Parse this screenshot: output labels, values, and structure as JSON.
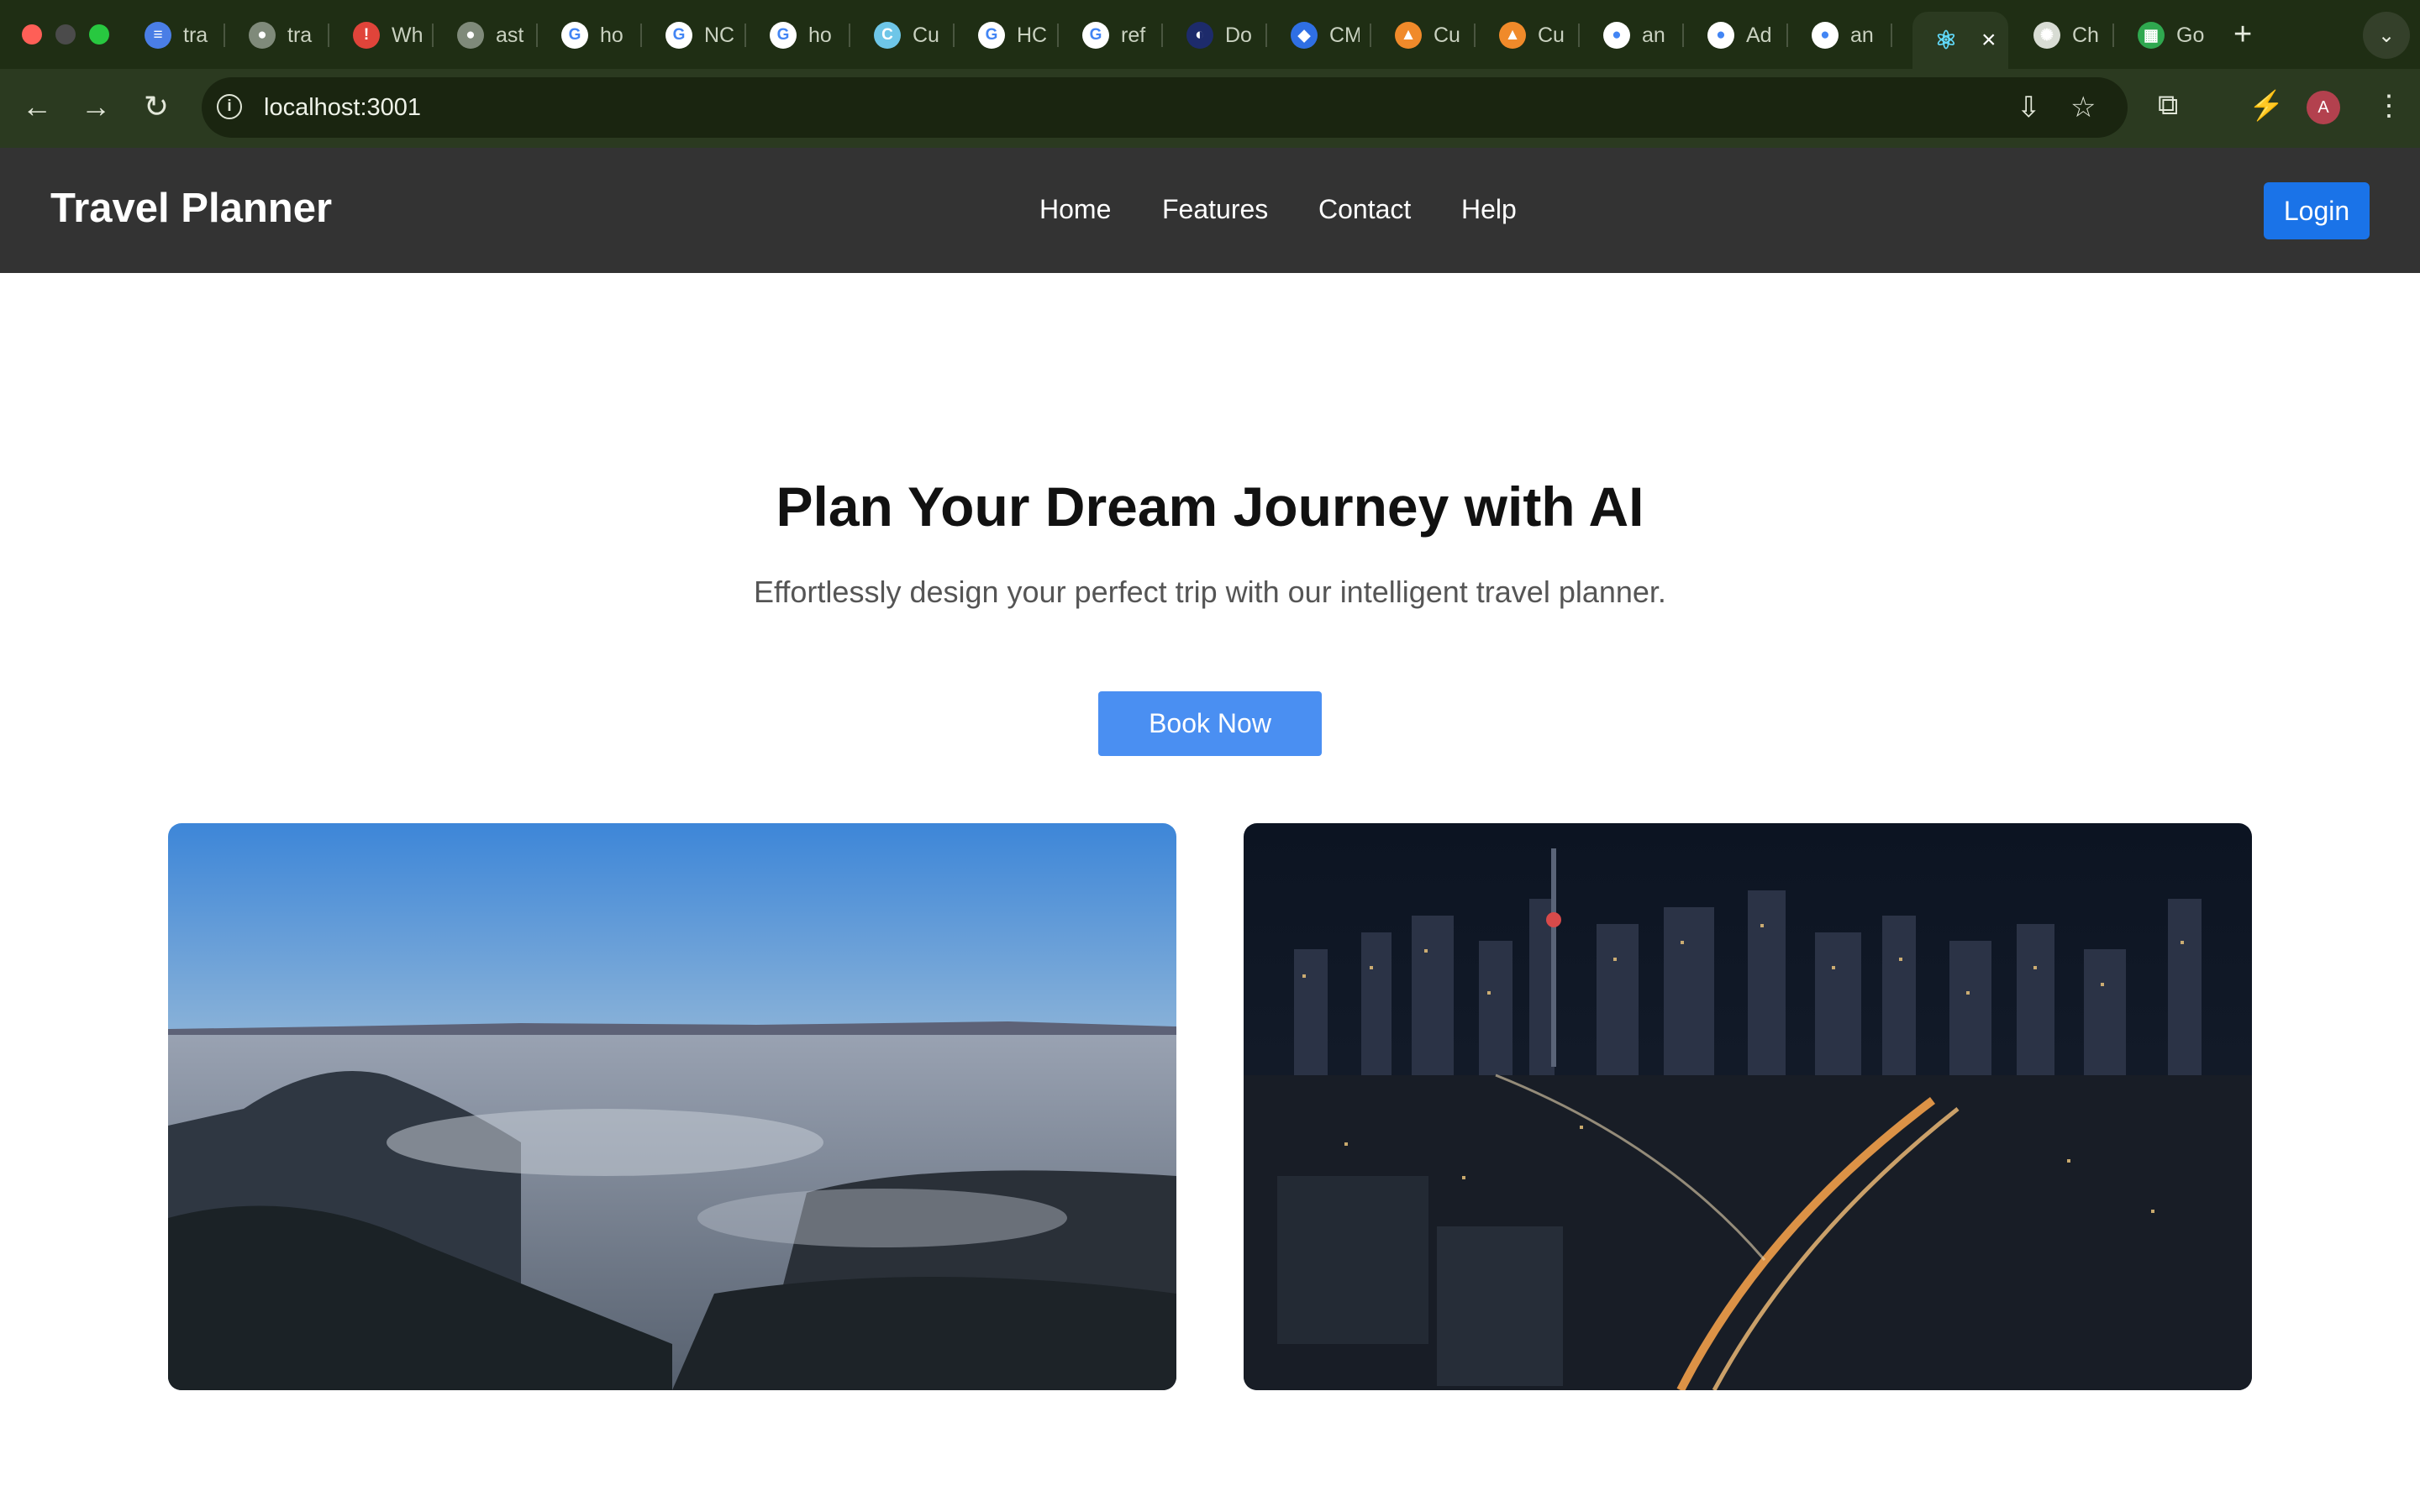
{
  "browser": {
    "tabs": [
      {
        "label": "tra",
        "icon": "docs-icon",
        "color": "#4a7ee6",
        "glyph": "≡"
      },
      {
        "label": "tra",
        "icon": "globe-icon",
        "color": "#7f8a7a",
        "glyph": "●"
      },
      {
        "label": "Wh",
        "icon": "alert-icon",
        "color": "#e0443a",
        "glyph": "!"
      },
      {
        "label": "ast",
        "icon": "globe-icon",
        "color": "#7f8a7a",
        "glyph": "●"
      },
      {
        "label": "ho",
        "icon": "google-icon",
        "color": "#ffffff",
        "glyph": "G"
      },
      {
        "label": "NC",
        "icon": "google-icon",
        "color": "#ffffff",
        "glyph": "G"
      },
      {
        "label": "ho",
        "icon": "google-icon",
        "color": "#ffffff",
        "glyph": "G"
      },
      {
        "label": "Cu",
        "icon": "cursor-icon",
        "color": "#6ec6e8",
        "glyph": "C"
      },
      {
        "label": "HC",
        "icon": "google-icon",
        "color": "#ffffff",
        "glyph": "G"
      },
      {
        "label": "ref",
        "icon": "google-icon",
        "color": "#ffffff",
        "glyph": "G"
      },
      {
        "label": "Do",
        "icon": "moon-icon",
        "color": "#1d2b6b",
        "glyph": "◐"
      },
      {
        "label": "CM",
        "icon": "jira-icon",
        "color": "#2f6fe4",
        "glyph": "◆"
      },
      {
        "label": "Cu",
        "icon": "flame-icon",
        "color": "#f08a2a",
        "glyph": "▲"
      },
      {
        "label": "Cu",
        "icon": "flame-icon",
        "color": "#f08a2a",
        "glyph": "▲"
      },
      {
        "label": "an",
        "icon": "github-icon",
        "color": "#ffffff",
        "glyph": "●"
      },
      {
        "label": "Ad",
        "icon": "github-icon",
        "color": "#ffffff",
        "glyph": "●"
      },
      {
        "label": "an",
        "icon": "github-icon",
        "color": "#ffffff",
        "glyph": "●"
      }
    ],
    "active_tab": {
      "icon": "react-icon",
      "color": "#61dafb",
      "glyph": "⚛",
      "close": "×"
    },
    "trailing_tabs": [
      {
        "label": "Ch",
        "icon": "openai-icon",
        "color": "#d8dcd4",
        "glyph": "✺"
      },
      {
        "label": "Go",
        "icon": "sheets-icon",
        "color": "#2fa84f",
        "glyph": "▦"
      }
    ],
    "new_tab": "+",
    "tab_menu": "⌄",
    "back": "←",
    "forward": "→",
    "reload": "↻",
    "site_info": "i",
    "url": "localhost:3001",
    "install_icon": "⇩",
    "star_icon": "☆",
    "extensions_icon": "⧉",
    "performance_icon": "⚡",
    "profile_initial": "A",
    "menu_icon": "⋮"
  },
  "app": {
    "brand": "Travel Planner",
    "nav": [
      "Home",
      "Features",
      "Contact",
      "Help"
    ],
    "login": "Login"
  },
  "hero": {
    "title": "Plan Your Dream Journey with AI",
    "subtitle": "Effortlessly design your perfect trip with our intelligent travel planner.",
    "cta": "Book Now"
  },
  "colors": {
    "brand_blue": "#1a73e8",
    "cta_blue": "#4a8ff2",
    "header_bg": "#333333",
    "chrome_bg": "#1f2e14"
  }
}
